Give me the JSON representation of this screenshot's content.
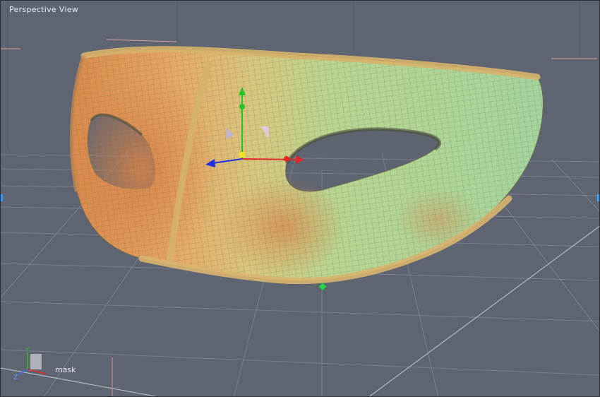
{
  "viewport": {
    "title": "Perspective View",
    "object_name": "mask"
  },
  "colors": {
    "background": "#5e6472",
    "grid": "#767c88",
    "mask_warm": "#e39a55",
    "mask_cool": "#a8d69a",
    "gizmo_x": "#e02828",
    "gizmo_y": "#23c423",
    "gizmo_z": "#2030e0"
  },
  "icons": {
    "move_gizmo": "translate-gizmo-icon",
    "axis_triad": "xyz-axis-icon",
    "pivot_point": "pivot-point-icon"
  }
}
